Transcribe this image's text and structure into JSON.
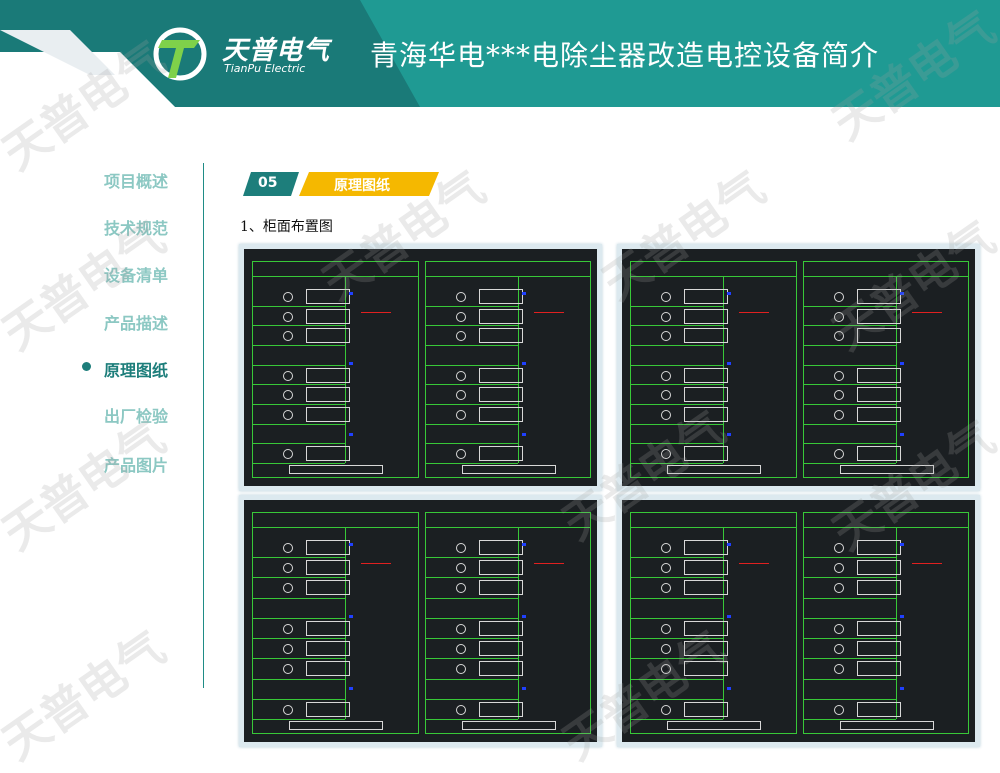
{
  "header": {
    "logo_cn": "天普电气",
    "logo_en": "TianPu Electric",
    "title": "青海华电***电除尘器改造电控设备简介"
  },
  "nav": {
    "items": [
      {
        "label": "项目概述"
      },
      {
        "label": "技术规范"
      },
      {
        "label": "设备清单"
      },
      {
        "label": "产品描述"
      },
      {
        "label": "原理图纸"
      },
      {
        "label": "出厂检验"
      },
      {
        "label": "产品图片"
      }
    ],
    "active_index": 4
  },
  "section": {
    "number": "05",
    "title": "原理图纸",
    "sub_heading": "1、柜面布置图"
  },
  "watermark": "天普电气",
  "colors": {
    "teal_dark": "#1a7a78",
    "teal": "#1f9a93",
    "nav_inactive": "#8cc8c3",
    "tag_teal": "#1d7e7b",
    "tag_yellow": "#f5b800",
    "drawing_bg": "#1b1f22",
    "cad_green": "#38c838",
    "cad_red": "#e02020"
  },
  "drawings": [
    {
      "name": "drawing-top-left"
    },
    {
      "name": "drawing-top-right"
    },
    {
      "name": "drawing-bottom-left"
    },
    {
      "name": "drawing-bottom-right"
    }
  ]
}
